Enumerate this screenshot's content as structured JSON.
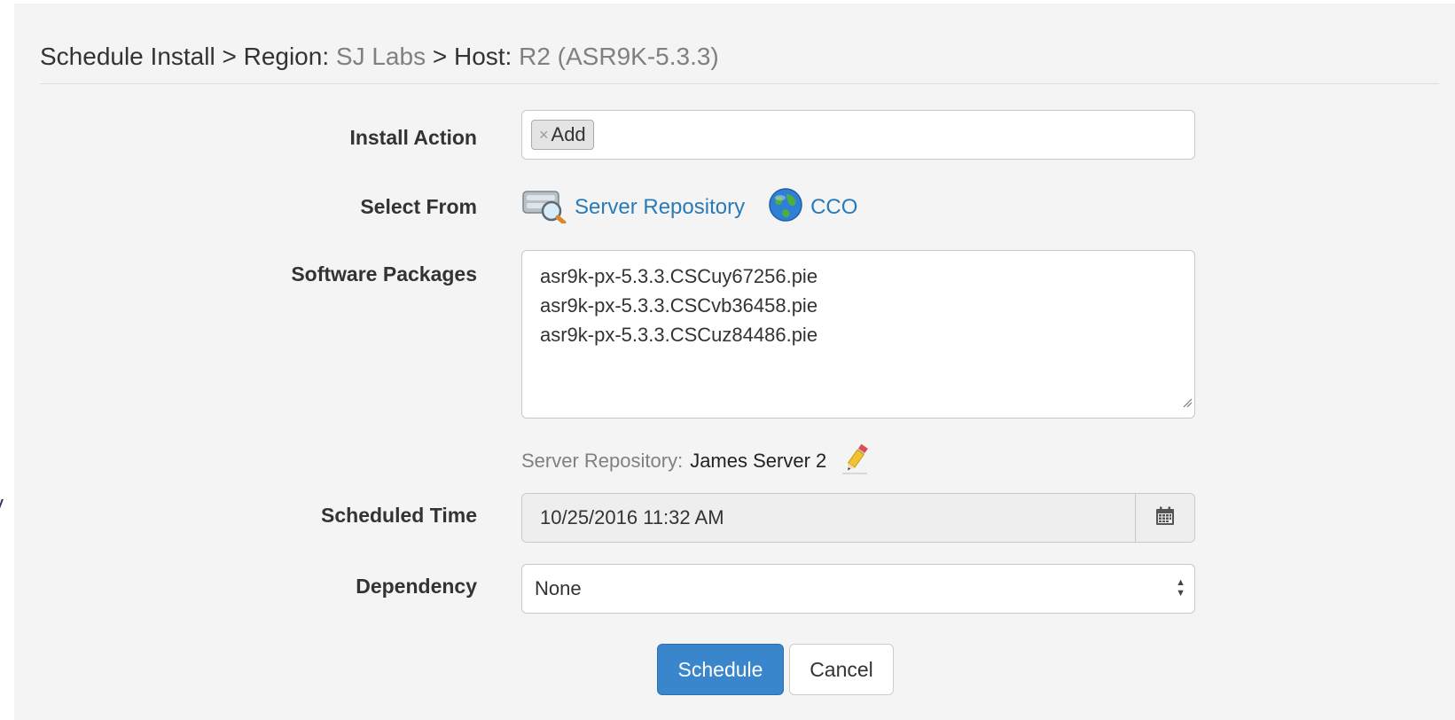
{
  "edge_glyph": "y",
  "header": {
    "prefix": "Schedule Install > Region: ",
    "region": "SJ Labs",
    "host_prefix": " > Host: ",
    "host": "R2 (ASR9K-5.3.3)"
  },
  "form": {
    "install_action": {
      "label": "Install Action",
      "tags": [
        {
          "remove_glyph": "×",
          "text": "Add"
        }
      ]
    },
    "select_from": {
      "label": "Select From",
      "sources": [
        {
          "label": "Server Repository",
          "icon": "server-search-icon"
        },
        {
          "label": "CCO",
          "icon": "globe-icon"
        }
      ]
    },
    "software_packages": {
      "label": "Software Packages",
      "lines": [
        "asr9k-px-5.3.3.CSCuy67256.pie",
        "asr9k-px-5.3.3.CSCvb36458.pie",
        "asr9k-px-5.3.3.CSCuz84486.pie"
      ]
    },
    "server_repository": {
      "label": "Server Repository:",
      "value": "James Server 2",
      "edit_icon": "pencil-icon"
    },
    "scheduled_time": {
      "label": "Scheduled Time",
      "value": "10/25/2016 11:32 AM",
      "icon": "calendar-icon"
    },
    "dependency": {
      "label": "Dependency",
      "selected": "None"
    }
  },
  "buttons": {
    "schedule": "Schedule",
    "cancel": "Cancel"
  },
  "colors": {
    "link": "#2a7ab8",
    "primary": "#3a86cc",
    "panel_bg": "#f4f4f4",
    "muted_text": "#808080"
  }
}
